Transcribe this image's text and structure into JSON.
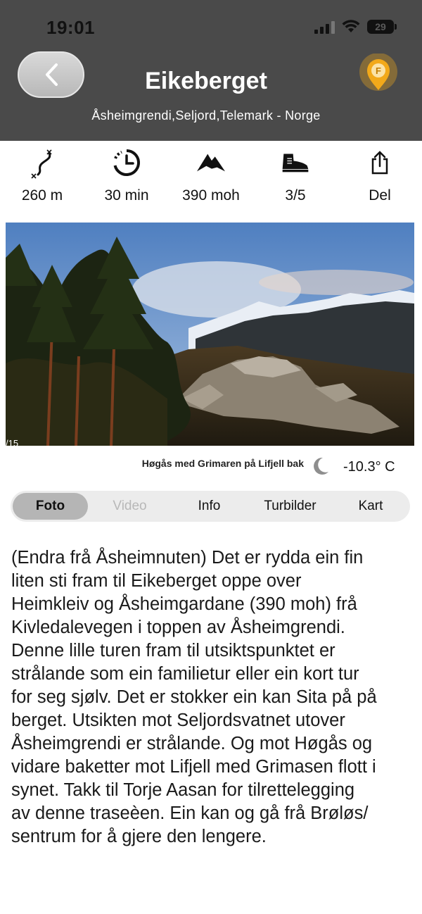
{
  "status_bar": {
    "time": "19:01",
    "battery": "29"
  },
  "header": {
    "title": "Eikeberget",
    "subtitle": "Åsheimgrendi,Seljord,Telemark - Norge",
    "pin_letter": "F",
    "pin_color": "#f2a91a"
  },
  "stats": [
    {
      "icon": "route-icon",
      "value": "260 m"
    },
    {
      "icon": "clock-history-icon",
      "value": "30 min"
    },
    {
      "icon": "mountain-icon",
      "value": "390 moh"
    },
    {
      "icon": "hiking-boot-icon",
      "value": "3/5"
    },
    {
      "icon": "share-icon",
      "value": "Del"
    }
  ],
  "photo": {
    "counter": "/15",
    "caption": "Høgås med Grimaren på Lifjell bak"
  },
  "weather": {
    "icon": "moon-icon",
    "temperature": "-10.3° C"
  },
  "tabs": [
    {
      "label": "Foto",
      "state": "active"
    },
    {
      "label": "Video",
      "state": "disabled"
    },
    {
      "label": "Info",
      "state": "normal"
    },
    {
      "label": "Turbilder",
      "state": "normal"
    },
    {
      "label": "Kart",
      "state": "normal"
    }
  ],
  "description": "(Endra frå Åsheimnuten) Det er rydda ein fin\nliten sti fram til Eikeberget oppe over\nHeimkleiv og Åsheimgardane (390 moh) frå\nKivledalevegen i toppen av Åsheimgrendi.\nDenne lille turen fram til utsiktspunktet er\nstrålande som ein familietur eller ein kort tur\nfor seg sjølv. Det er stokker ein kan Sita på på\nberget. Utsikten mot Seljordsvatnet utover\nÅsheimgrendi er strålande. Og mot Høgås og\nvidare baketter mot Lifjell med Grimasen flott i\nsynet. Takk til Torje Aasan for tilrettelegging\nav denne traseèen. Ein kan og gå frå Brøløs/\nsentrum for å gjere den lengere.",
  "colors": {
    "header_bg": "#4a4a4a",
    "tab_bar_bg": "#ececec",
    "tab_active_bg": "#b5b5b5"
  }
}
